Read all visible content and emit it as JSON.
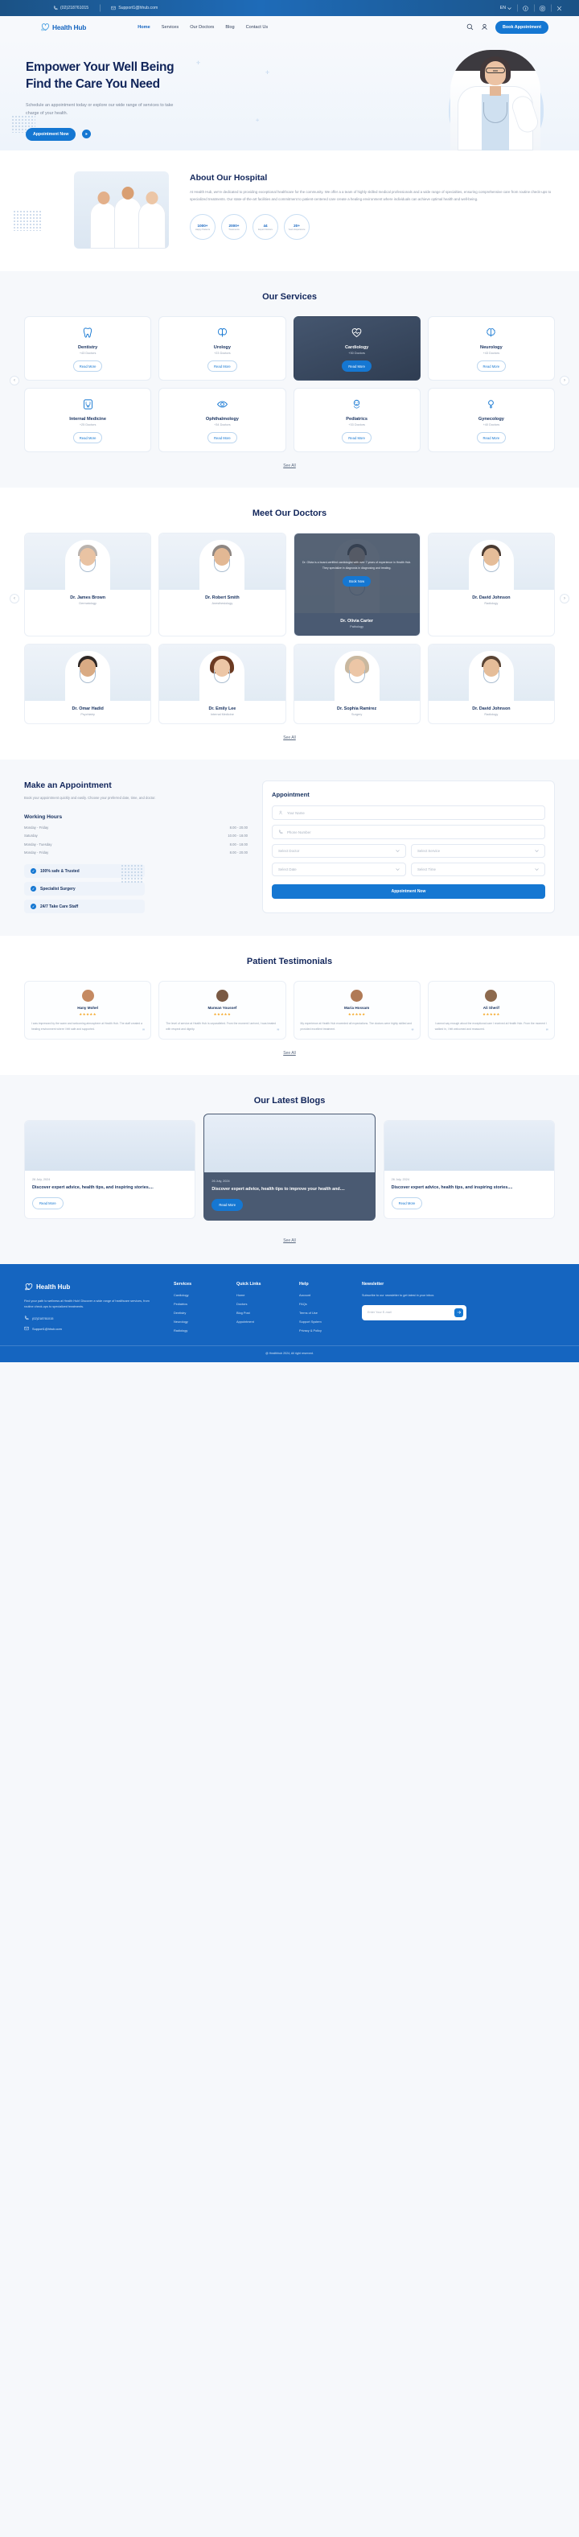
{
  "topbar": {
    "phone": "(02)218761015",
    "email": "Support1@hhub.com",
    "lang": "EN",
    "icons": {
      "phone": "phone-icon",
      "mail": "mail-icon",
      "chevron": "chevron-down-icon",
      "facebook": "facebook-icon",
      "instagram": "instagram-icon",
      "x": "x-twitter-icon"
    }
  },
  "nav": {
    "brand": "Health Hub",
    "links": [
      {
        "label": "Home",
        "active": true
      },
      {
        "label": "Services",
        "active": false
      },
      {
        "label": "Our Doctors",
        "active": false
      },
      {
        "label": "Blog",
        "active": false
      },
      {
        "label": "Contact Us",
        "active": false
      }
    ],
    "search_icon": "search-icon",
    "account_icon": "user-icon",
    "cta": "Book Appointment"
  },
  "hero": {
    "title_line1": "Empower Your Well Being",
    "title_line2": "Find the Care You Need",
    "desc": "Schedule an appointment today or explore our wide range of services to take charge of your health.",
    "cta": "Appointment Now",
    "play_icon": "play-icon"
  },
  "about": {
    "title": "About Our Hospital",
    "desc": "At Health Hub, we're dedicated to providing exceptional healthcare for the community. We offer a a team of highly skilled medical professionals and a wide range of specialties, ensuring comprehensive care from routine check-ups to specialized treatments. Our state-of-the-art facilities and commitment to patient-centered care create a healing environment where individuals can achieve optimal health and well-being.",
    "stats": [
      {
        "num": "1000+",
        "label": "Happy Patients"
      },
      {
        "num": "2000+",
        "label": "Treatments"
      },
      {
        "num": "44",
        "label": "Expert Doctors"
      },
      {
        "num": "20+",
        "label": "Years Experience"
      }
    ]
  },
  "services": {
    "title": "Our Services",
    "see_all": "See All",
    "items": [
      {
        "name": "Dentistry",
        "count": "+43 Doctors",
        "btn": "Read More",
        "icon": "tooth-icon",
        "active": false
      },
      {
        "name": "Urology",
        "count": "+23 Doctors",
        "btn": "Read More",
        "icon": "kidney-icon",
        "active": false
      },
      {
        "name": "Cardiology",
        "count": "+30 Doctors",
        "btn": "Read More",
        "icon": "heart-icon",
        "active": true
      },
      {
        "name": "Neurology",
        "count": "+43 Doctors",
        "btn": "Read More",
        "icon": "brain-icon",
        "active": false
      },
      {
        "name": "Internal Medicine",
        "count": "+25 Doctors",
        "btn": "Read More",
        "icon": "stethoscope-icon",
        "active": false
      },
      {
        "name": "Ophthalmology",
        "count": "+34 Doctors",
        "btn": "Read More",
        "icon": "eye-icon",
        "active": false
      },
      {
        "name": "Pediatrics",
        "count": "+33 Doctors",
        "btn": "Read More",
        "icon": "baby-icon",
        "active": false
      },
      {
        "name": "Gynecology",
        "count": "+40 Doctors",
        "btn": "Read More",
        "icon": "uterus-icon",
        "active": false
      }
    ]
  },
  "doctors": {
    "title": "Meet Our Doctors",
    "see_all": "See All",
    "featured_overlay": "Dr. Olivia is a board-certified cardiologist with over 7 years of experience in Health Hub. They specialize in diagnosis in diagnosing and treating.",
    "featured_btn": "Book Now",
    "items": [
      {
        "name": "Dr. James Brown",
        "spec": "Dermatology",
        "featured": false,
        "hair": "#b9b2ad",
        "skin": "#e9c3a3"
      },
      {
        "name": "Dr. Robert Smith",
        "spec": "Anesthesiology",
        "featured": false,
        "hair": "#8e8681",
        "skin": "#e2b894"
      },
      {
        "name": "Dr. Olivia Carter",
        "spec": "Pathology",
        "featured": true,
        "hair": "#3a3330",
        "skin": "#e9c3a3"
      },
      {
        "name": "Dr. David Johnson",
        "spec": "Radiology",
        "featured": false,
        "hair": "#4a3a30",
        "skin": "#e5bd99"
      },
      {
        "name": "Dr. Omar Hadid",
        "spec": "Psychiatry",
        "featured": false,
        "hair": "#2e2724",
        "skin": "#d9ab84"
      },
      {
        "name": "Dr. Emily Lee",
        "spec": "Internal Medicine",
        "featured": false,
        "hair": "#6b3a22",
        "skin": "#ecc6a6"
      },
      {
        "name": "Dr. Sophia Ramirez",
        "spec": "Surgery",
        "featured": false,
        "hair": "#c9b89f",
        "skin": "#ecc6a6"
      },
      {
        "name": "Dr. David Johnson",
        "spec": "Radiology",
        "featured": false,
        "hair": "#5a4434",
        "skin": "#e5bd99"
      }
    ]
  },
  "appointment": {
    "title": "Make an Appointment",
    "sub": "Book your appointment quickly and easily. Choose your preferred date, time, and doctor.",
    "hours_title": "Working Hours",
    "hours": [
      {
        "day": "Monday - Friday",
        "time": "8.00 - 20.00"
      },
      {
        "day": "Saturday",
        "time": "10.00 - 18.00"
      },
      {
        "day": "Monday - Tuesday",
        "time": "8.00 - 18.00"
      },
      {
        "day": "Monday - Friday",
        "time": "8.00 - 20.00"
      }
    ],
    "features": [
      "100% safe & Trusted",
      "Specialist Surgery",
      "24/7 Take Care Staff"
    ],
    "card_title": "Appointment",
    "fields": {
      "name_placeholder": "Your Name",
      "phone_placeholder": "Phone Number",
      "doctor_placeholder": "Select Doctor",
      "service_placeholder": "Select Service",
      "date_placeholder": "Select Date",
      "time_placeholder": "Select Time"
    },
    "submit": "Appointment Now"
  },
  "testimonials": {
    "title": "Patient Testimonials",
    "see_all": "See All",
    "items": [
      {
        "name": "Hany Mohel",
        "stars": "★★★★★",
        "text": "I was impressed by the warm and welcoming atmosphere at Health Hub. The staff created a healing environment where I felt safe and supported.",
        "avatar_bg": "#c58a62"
      },
      {
        "name": "Marwan Youssef",
        "stars": "★★★★★",
        "text": "The level of service at Health Hub is unparalleled. From the moment I arrived, I was treated with respect and dignity.",
        "avatar_bg": "#7a5a44"
      },
      {
        "name": "Maria Hossam",
        "stars": "★★★★★",
        "text": "My experience at Health Hub exceeded all expectations. The doctors were highly skilled and provided excellent treatment.",
        "avatar_bg": "#b07a56"
      },
      {
        "name": "Ali Sherif",
        "stars": "★★★★★",
        "text": "I cannot say enough about the exceptional care I received at Health Hub. From the moment I walked in, I felt welcomed and reassured.",
        "avatar_bg": "#8d6a4e"
      }
    ]
  },
  "blogs": {
    "title": "Our Latest Blogs",
    "see_all": "See All",
    "items": [
      {
        "date": "26 July, 2024",
        "title": "Discover expert advice, health tips, and inspiring stories....",
        "btn": "Read More",
        "featured": false
      },
      {
        "date": "26 July, 2024",
        "title": "Discover expert advice, health tips to improve your health and....",
        "btn": "Read More",
        "featured": true
      },
      {
        "date": "26 July, 2024",
        "title": "Discover expert advice, health tips, and inspiring stories....",
        "btn": "Read More",
        "featured": false
      }
    ]
  },
  "footer": {
    "brand": "Health Hub",
    "desc": "Find your path to wellness at Health Hub! Discover a wide range of healthcare services, from routine check-ups to specialized treatments.",
    "phone": "(02)218761015",
    "email": "Support1@hhub.com",
    "columns": [
      {
        "title": "Services",
        "links": [
          "Cardiology",
          "Pediatrics",
          "Dentistry",
          "Neurology",
          "Radiology"
        ]
      },
      {
        "title": "Quick Links",
        "links": [
          "Home",
          "Doctors",
          "Blog Post",
          "Appointment"
        ]
      },
      {
        "title": "Help",
        "links": [
          "Account",
          "FAQs",
          "Terms of Use",
          "Support System",
          "Privacy & Policy"
        ]
      }
    ],
    "newsletter": {
      "title": "Newsletter",
      "desc": "Subscribe to our newsletter to get latest in your inbox.",
      "placeholder": "Enter Your E-mail",
      "send_icon": "send-icon"
    },
    "copyright": "@ Healthhub 2024, All right reserved."
  }
}
